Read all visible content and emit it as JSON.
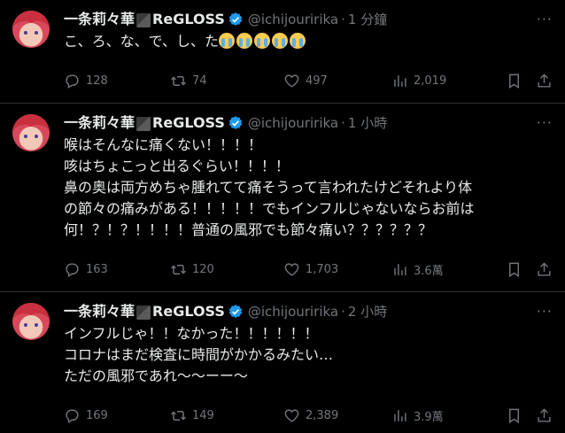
{
  "tweets": [
    {
      "name": "一条莉々華",
      "group": "ReGLOSS",
      "handle": "@ichijouririka",
      "time": "1 分鐘",
      "text": "こ、ろ、な、で、し、た",
      "cry_emoji_count": 5,
      "replies": "128",
      "retweets": "74",
      "likes": "497",
      "views": "2,019"
    },
    {
      "name": "一条莉々華",
      "group": "ReGLOSS",
      "handle": "@ichijouririka",
      "time": "1 小時",
      "text": "喉はそんなに痛くない！！！！\n咳はちょこっと出るぐらい！！！！\n鼻の奥は両方めちゃ腫れてて痛そうって言われたけどそれより体\nの節々の痛みがある！！！！！でもインフルじゃないならお前は\n何！？！？！！！！普通の風邪でも節々痛い？？？？？？",
      "replies": "163",
      "retweets": "120",
      "likes": "1,703",
      "views": "3.6萬"
    },
    {
      "name": "一条莉々華",
      "group": "ReGLOSS",
      "handle": "@ichijouririka",
      "time": "2 小時",
      "text": "インフルじゃ！！なかった！！！！！！\nコロナはまだ検査に時間がかかるみたい…\nただの風邪であれ〜〜ーー〜",
      "replies": "169",
      "retweets": "149",
      "likes": "2,389",
      "views": "3.9萬"
    }
  ],
  "colors": {
    "background": "#000000",
    "text": "#e7e9ea",
    "muted": "#71767b",
    "verified": "#1d9bf0",
    "divider": "#2f3336"
  },
  "icons": [
    "reply-icon",
    "retweet-icon",
    "like-icon",
    "views-icon",
    "bookmark-icon",
    "share-icon",
    "verified-icon",
    "more-icon"
  ],
  "more_label": "···"
}
